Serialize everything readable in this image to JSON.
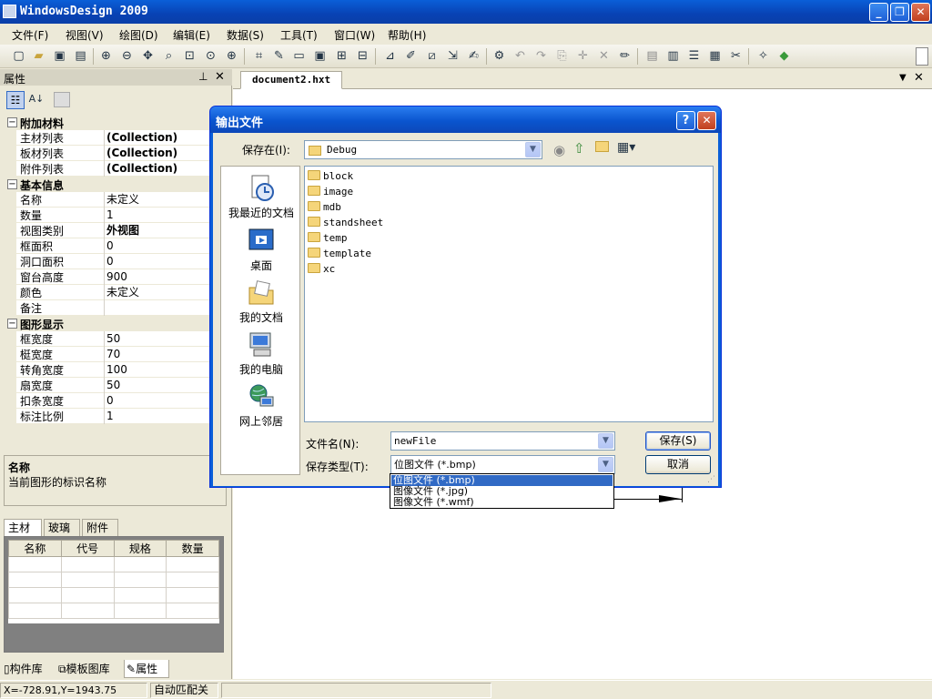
{
  "window": {
    "title": "WindowsDesign 2009"
  },
  "menu": [
    "文件(F)",
    "视图(V)",
    "绘图(D)",
    "编辑(E)",
    "数据(S)",
    "工具(T)",
    "窗口(W)",
    "帮助(H)"
  ],
  "properties_panel": {
    "title": "属性",
    "categories": [
      {
        "name": "附加材料",
        "rows": [
          {
            "key": "主材列表",
            "value": "(Collection)",
            "bold": true
          },
          {
            "key": "板材列表",
            "value": "(Collection)",
            "bold": true
          },
          {
            "key": "附件列表",
            "value": "(Collection)",
            "bold": true
          }
        ]
      },
      {
        "name": "基本信息",
        "rows": [
          {
            "key": "名称",
            "value": "未定义"
          },
          {
            "key": "数量",
            "value": "1"
          },
          {
            "key": "视图类别",
            "value": "外视图",
            "bold": true
          },
          {
            "key": "框面积",
            "value": "0"
          },
          {
            "key": "洞口面积",
            "value": "0"
          },
          {
            "key": "窗台高度",
            "value": "900"
          },
          {
            "key": "颜色",
            "value": "未定义"
          },
          {
            "key": "备注",
            "value": ""
          }
        ]
      },
      {
        "name": "图形显示",
        "rows": [
          {
            "key": "框宽度",
            "value": "50"
          },
          {
            "key": "梃宽度",
            "value": "70"
          },
          {
            "key": "转角宽度",
            "value": "100"
          },
          {
            "key": "扇宽度",
            "value": "50"
          },
          {
            "key": "扣条宽度",
            "value": "0"
          },
          {
            "key": "标注比例",
            "value": "1"
          }
        ]
      }
    ],
    "description": {
      "title": "名称",
      "text": "当前图形的标识名称"
    },
    "tabs": [
      "主材",
      "玻璃",
      "附件"
    ],
    "table_headers": [
      "名称",
      "代号",
      "规格",
      "数量"
    ]
  },
  "left_tabs": [
    "构件库",
    "模板图库",
    "属性"
  ],
  "document": {
    "tab": "document2.hxt"
  },
  "status": {
    "coords": "X=-728.91,Y=1943.75",
    "snap": "自动匹配关"
  },
  "dialog": {
    "title": "输出文件",
    "save_in_label": "保存在(I):",
    "save_in_value": "Debug",
    "places": [
      "我最近的文档",
      "桌面",
      "我的文档",
      "我的电脑",
      "网上邻居"
    ],
    "folders": [
      "block",
      "image",
      "mdb",
      "standsheet",
      "temp",
      "template",
      "xc"
    ],
    "filename_label": "文件名(N):",
    "filename_value": "newFile",
    "filetype_label": "保存类型(T):",
    "filetype_value": "位图文件 (*.bmp)",
    "filetype_options": [
      "位图文件 (*.bmp)",
      "图像文件 (*.jpg)",
      "图像文件 (*.wmf)"
    ],
    "save_button": "保存(S)",
    "cancel_button": "取消"
  }
}
